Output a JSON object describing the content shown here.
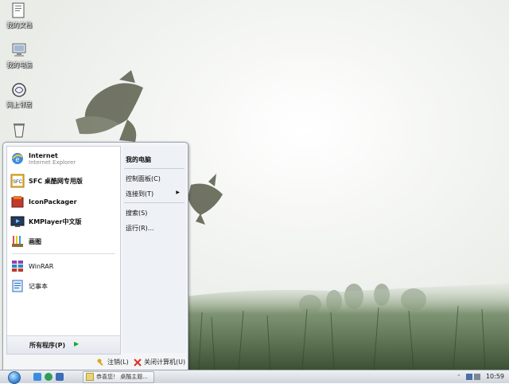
{
  "desktop": {
    "icons": [
      {
        "label": "我的文档",
        "icon": "documents-icon"
      },
      {
        "label": "我的电脑",
        "icon": "computer-icon"
      },
      {
        "label": "网上邻居",
        "icon": "network-icon"
      },
      {
        "label": "",
        "icon": "recycle-bin-icon"
      }
    ]
  },
  "start_menu": {
    "pinned": [
      {
        "name": "Internet",
        "sub": "Internet Explorer",
        "icon": "ie-icon"
      },
      {
        "name": "SFC 桌酷网专用版",
        "icon": "sfc-icon"
      },
      {
        "name": "IconPackager",
        "icon": "iconpackager-icon"
      },
      {
        "name": "KMPlayer中文版",
        "icon": "kmplayer-icon"
      },
      {
        "name": "画图",
        "icon": "paint-icon"
      }
    ],
    "recent": [
      {
        "name": "WinRAR",
        "icon": "winrar-icon"
      },
      {
        "name": "记事本",
        "icon": "notepad-icon"
      }
    ],
    "all_programs": "所有程序(P)",
    "right": {
      "my_computer": "我的电脑",
      "control_panel": "控制面板(C)",
      "connect_to": "连接到(T)",
      "search": "搜索(S)",
      "run": "运行(R)..."
    },
    "logoff": "注销(L)",
    "shutdown": "关闭计算机(U)"
  },
  "taskbar": {
    "task_button": "恭喜您！ 桌酷主题...",
    "clock": "10:59"
  },
  "colors": {
    "accent": "#3f8ad8",
    "shutdown_red": "#d9322b",
    "logoff_orange": "#e0a21f"
  }
}
